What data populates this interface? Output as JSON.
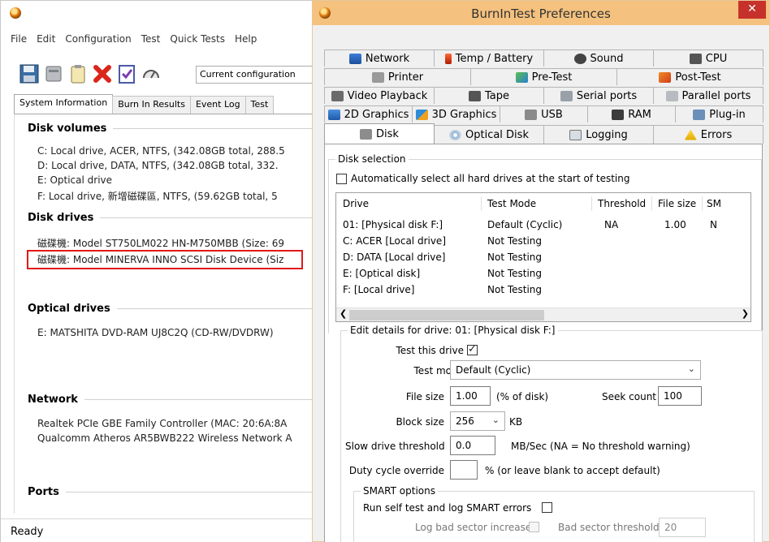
{
  "main": {
    "menu": [
      "File",
      "Edit",
      "Configuration",
      "Test",
      "Quick Tests",
      "Help"
    ],
    "config_value": "Current configuration",
    "tabs": [
      "System Information",
      "Burn In Results",
      "Event Log",
      "Test"
    ],
    "sections": {
      "disk_volumes": "Disk volumes",
      "disk_drives": "Disk drives",
      "optical_drives": "Optical drives",
      "network": "Network",
      "ports": "Ports"
    },
    "volumes": [
      "C: Local drive, ACER, NTFS, (342.08GB total, 288.5",
      "D: Local drive, DATA, NTFS, (342.08GB total, 332.",
      "E: Optical drive",
      "F: Local drive, 新增磁碟區, NTFS, (59.62GB total, 5"
    ],
    "drives": [
      "磁碟機: Model ST750LM022 HN-M750MBB (Size: 69",
      "磁碟機: Model MINERVA INNO SCSI Disk Device (Siz"
    ],
    "optical": [
      "E: MATSHITA DVD-RAM UJ8C2Q (CD-RW/DVDRW)"
    ],
    "network": [
      "Realtek PCIe GBE Family Controller (MAC: 20:6A:8A",
      "Qualcomm Atheros AR5BWB222 Wireless Network A"
    ],
    "status": "Ready"
  },
  "prefs": {
    "title": "BurnInTest Preferences",
    "close_glyph": "✕",
    "tabs_row1": [
      "Network",
      "Temp / Battery",
      "Sound",
      "CPU"
    ],
    "tabs_row2": [
      "Printer",
      "Pre-Test",
      "Post-Test"
    ],
    "tabs_row3": [
      "Video Playback",
      "Tape",
      "Serial ports",
      "Parallel ports"
    ],
    "tabs_row4": [
      "2D Graphics",
      "3D Graphics",
      "USB",
      "RAM",
      "Plug-in"
    ],
    "tabs_row5": [
      "Disk",
      "Optical Disk",
      "Logging",
      "Errors"
    ],
    "disk_selection": {
      "legend": "Disk selection",
      "auto_select_label": "Automatically select all hard drives at the start of testing",
      "auto_select_checked": false,
      "columns": [
        "Drive",
        "Test Mode",
        "Threshold",
        "File size",
        "SM"
      ],
      "rows": [
        {
          "drive": "01:  [Physical disk F:]",
          "mode": "Default (Cyclic)",
          "threshold": "NA",
          "file_size": "1.00",
          "smart": "N"
        },
        {
          "drive": "C:  ACER [Local drive]",
          "mode": "Not Testing",
          "threshold": "",
          "file_size": "",
          "smart": ""
        },
        {
          "drive": "D:  DATA [Local drive]",
          "mode": "Not Testing",
          "threshold": "",
          "file_size": "",
          "smart": ""
        },
        {
          "drive": "E:  [Optical disk]",
          "mode": "Not Testing",
          "threshold": "",
          "file_size": "",
          "smart": ""
        },
        {
          "drive": "F:  [Local drive]",
          "mode": "Not Testing",
          "threshold": "",
          "file_size": "",
          "smart": ""
        }
      ]
    },
    "edit": {
      "legend": "Edit details for drive: 01:  [Physical disk F:]",
      "test_this_drive_label": "Test this drive",
      "test_this_drive_checked": true,
      "test_mode_label": "Test mode",
      "test_mode_value": "Default (Cyclic)",
      "file_size_label": "File size",
      "file_size_value": "1.00",
      "file_size_unit": "(% of disk)",
      "seek_count_label": "Seek count",
      "seek_count_value": "100",
      "block_size_label": "Block size",
      "block_size_value": "256",
      "block_size_unit": "KB",
      "slow_threshold_label": "Slow drive threshold",
      "slow_threshold_value": "0.0",
      "slow_threshold_unit": "MB/Sec  (NA = No threshold warning)",
      "duty_cycle_label": "Duty cycle override",
      "duty_cycle_value": "",
      "duty_cycle_unit": "% (or leave blank to accept default)",
      "smart_legend": "SMART options",
      "smart_self_test_label": "Run self test and log SMART errors",
      "log_bad_sector_label": "Log bad sector increase",
      "bad_sector_threshold_label": "Bad sector threshold",
      "bad_sector_threshold_value": "20"
    }
  },
  "colors": {
    "title_bar": "#f4c17e",
    "close_button": "#c7312b",
    "highlight": "#e01a1a"
  }
}
